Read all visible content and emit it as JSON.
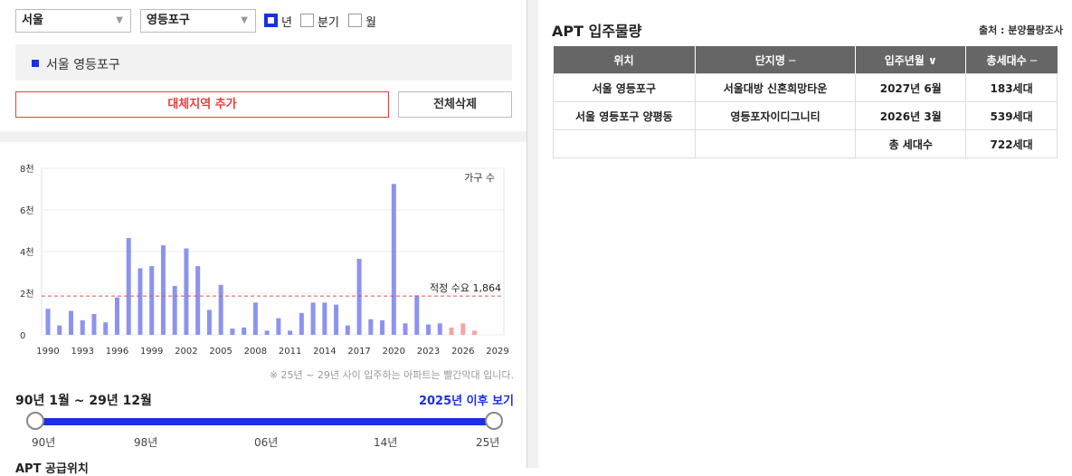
{
  "filters": {
    "city": "서울",
    "district": "영등포구",
    "period_options": [
      {
        "label": "년",
        "checked": true
      },
      {
        "label": "분기",
        "checked": false
      },
      {
        "label": "월",
        "checked": false
      }
    ]
  },
  "selected_region": "서울 영등포구",
  "buttons": {
    "add_region": "대체지역 추가",
    "delete_all": "전체삭제"
  },
  "chart_data": {
    "type": "bar",
    "legend": "가구 수",
    "yticks": [
      "8천",
      "6천",
      "4천",
      "2천",
      "0"
    ],
    "ylim": [
      0,
      8000
    ],
    "xticks": [
      "1990",
      "1993",
      "1996",
      "1999",
      "2002",
      "2005",
      "2008",
      "2011",
      "2014",
      "2017",
      "2020",
      "2023",
      "2026",
      "2029"
    ],
    "x": [
      1990,
      1991,
      1992,
      1993,
      1994,
      1995,
      1996,
      1997,
      1998,
      1999,
      2000,
      2001,
      2002,
      2003,
      2004,
      2005,
      2006,
      2007,
      2008,
      2009,
      2010,
      2011,
      2012,
      2013,
      2014,
      2015,
      2016,
      2017,
      2018,
      2019,
      2020,
      2021,
      2022,
      2023,
      2024,
      2025,
      2026,
      2027
    ],
    "values": [
      1250,
      450,
      1150,
      700,
      1000,
      600,
      1800,
      4650,
      3200,
      3300,
      4300,
      2350,
      4150,
      3300,
      1200,
      2400,
      300,
      350,
      1550,
      200,
      800,
      200,
      1050,
      1550,
      1550,
      1450,
      450,
      3650,
      750,
      700,
      7250,
      550,
      1900,
      500,
      550,
      350,
      550,
      200
    ],
    "highlight_from": 2025,
    "colors": {
      "normal": "#8c93ef",
      "future": "#f4a6a0",
      "ref_line": "#e05050"
    },
    "reference": {
      "value": 1864,
      "label": "적정 수요 1,864"
    }
  },
  "note": "※ 25년 ~ 29년 사이 입주하는 아파트는 빨간막대 입니다.",
  "range": {
    "label": "90년 1월 ~ 29년 12월",
    "later_link": "2025년 이후 보기",
    "ticks": [
      "90년",
      "98년",
      "06년",
      "14년",
      "25년"
    ]
  },
  "section_title_cut": "APT 공급위치",
  "right": {
    "title": "APT 입주물량",
    "source": "출처 : 분양물량조사",
    "columns": [
      "위치",
      "단지명 ─",
      "입주년월 ∨",
      "총세대수 ─"
    ],
    "rows": [
      [
        "서울 영등포구",
        "서울대방 신혼희망타운",
        "2027년 6월",
        "183세대"
      ],
      [
        "서울 영등포구 양평동",
        "영등포자이디그니티",
        "2026년 3월",
        "539세대"
      ],
      [
        "",
        "",
        "총 세대수",
        "722세대"
      ]
    ]
  }
}
